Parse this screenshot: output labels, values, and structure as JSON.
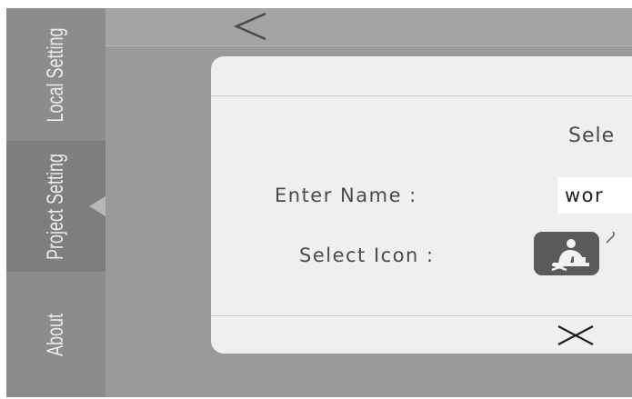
{
  "sidebar": {
    "items": [
      {
        "label": "Local Setting",
        "active": false
      },
      {
        "label": "Project Setting",
        "active": true
      },
      {
        "label": "About",
        "active": false
      }
    ]
  },
  "topbar": {
    "back_icon": "chevron-left-icon"
  },
  "dialog": {
    "title": "Sele",
    "name_label": "Enter Name :",
    "name_value": "wor",
    "icon_label": "Select Icon :",
    "selected_icon": "person-at-desk-icon",
    "close_icon": "close-icon"
  },
  "colors": {
    "sidebar": "#8c8c8c",
    "sidebar_active": "#7e7e7e",
    "background": "#9a9a9a",
    "dialog": "#efefef",
    "icon_tile": "#5a5a5a",
    "text": "#4a4a4a"
  }
}
